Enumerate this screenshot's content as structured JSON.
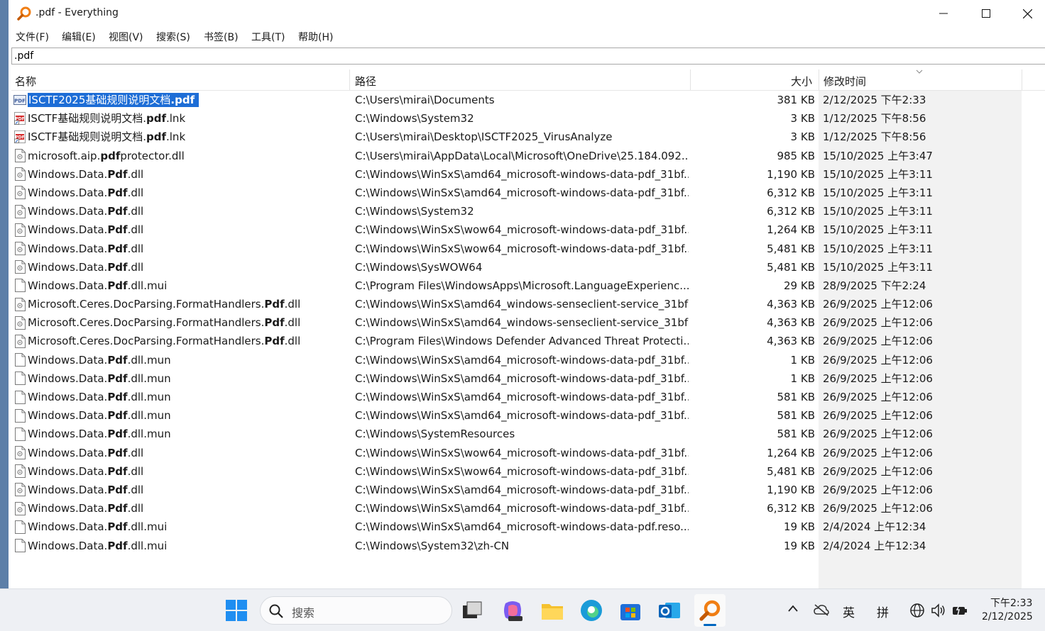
{
  "window": {
    "title": ".pdf - Everything",
    "app_icon": "magnifier-icon"
  },
  "menu": [
    "文件(F)",
    "编辑(E)",
    "视图(V)",
    "搜索(S)",
    "书签(B)",
    "工具(T)",
    "帮助(H)"
  ],
  "search": {
    "value": ".pdf"
  },
  "columns": {
    "name": "名称",
    "path": "路径",
    "size": "大小",
    "modified": "修改时间"
  },
  "rows": [
    {
      "pre": "ISCTF2025基础规则说明文档",
      "hl": ".pdf",
      "post": "",
      "path": "C:\\Users\\mirai\\Documents",
      "size": "381 KB",
      "modified": "2/12/2025 下午2:33",
      "icon": "pdf-file-icon",
      "selected": true
    },
    {
      "pre": "ISCTF基础规则说明文档.",
      "hl": "pdf",
      "post": ".lnk",
      "path": "C:\\Windows\\System32",
      "size": "3 KB",
      "modified": "1/12/2025 下午8:56",
      "icon": "pdf-shortcut-icon"
    },
    {
      "pre": "ISCTF基础规则说明文档.",
      "hl": "pdf",
      "post": ".lnk",
      "path": "C:\\Users\\mirai\\Desktop\\ISCTF2025_VirusAnalyze",
      "size": "3 KB",
      "modified": "1/12/2025 下午8:56",
      "icon": "pdf-shortcut-icon"
    },
    {
      "pre": "microsoft.aip.",
      "hl": "pdf",
      "post": "protector.dll",
      "path": "C:\\Users\\mirai\\AppData\\Local\\Microsoft\\OneDrive\\25.184.092...",
      "size": "985 KB",
      "modified": "15/10/2025 上午3:47",
      "icon": "dll-file-icon"
    },
    {
      "pre": "Windows.Data.",
      "hl": "Pdf",
      "post": ".dll",
      "path": "C:\\Windows\\WinSxS\\amd64_microsoft-windows-data-pdf_31bf...",
      "size": "1,190 KB",
      "modified": "15/10/2025 上午3:11",
      "icon": "dll-file-icon"
    },
    {
      "pre": "Windows.Data.",
      "hl": "Pdf",
      "post": ".dll",
      "path": "C:\\Windows\\WinSxS\\amd64_microsoft-windows-data-pdf_31bf...",
      "size": "6,312 KB",
      "modified": "15/10/2025 上午3:11",
      "icon": "dll-file-icon"
    },
    {
      "pre": "Windows.Data.",
      "hl": "Pdf",
      "post": ".dll",
      "path": "C:\\Windows\\System32",
      "size": "6,312 KB",
      "modified": "15/10/2025 上午3:11",
      "icon": "dll-file-icon"
    },
    {
      "pre": "Windows.Data.",
      "hl": "Pdf",
      "post": ".dll",
      "path": "C:\\Windows\\WinSxS\\wow64_microsoft-windows-data-pdf_31bf...",
      "size": "1,264 KB",
      "modified": "15/10/2025 上午3:11",
      "icon": "dll-file-icon"
    },
    {
      "pre": "Windows.Data.",
      "hl": "Pdf",
      "post": ".dll",
      "path": "C:\\Windows\\WinSxS\\wow64_microsoft-windows-data-pdf_31bf...",
      "size": "5,481 KB",
      "modified": "15/10/2025 上午3:11",
      "icon": "dll-file-icon"
    },
    {
      "pre": "Windows.Data.",
      "hl": "Pdf",
      "post": ".dll",
      "path": "C:\\Windows\\SysWOW64",
      "size": "5,481 KB",
      "modified": "15/10/2025 上午3:11",
      "icon": "dll-file-icon"
    },
    {
      "pre": "Windows.Data.",
      "hl": "Pdf",
      "post": ".dll.mui",
      "path": "C:\\Program Files\\WindowsApps\\Microsoft.LanguageExperienc...",
      "size": "29 KB",
      "modified": "28/9/2025 下午2:24",
      "icon": "file-icon"
    },
    {
      "pre": "Microsoft.Ceres.DocParsing.FormatHandlers.",
      "hl": "Pdf",
      "post": ".dll",
      "path": "C:\\Windows\\WinSxS\\amd64_windows-senseclient-service_31bf3...",
      "size": "4,363 KB",
      "modified": "26/9/2025 上午12:06",
      "icon": "dll-file-icon"
    },
    {
      "pre": "Microsoft.Ceres.DocParsing.FormatHandlers.",
      "hl": "Pdf",
      "post": ".dll",
      "path": "C:\\Windows\\WinSxS\\amd64_windows-senseclient-service_31bf3...",
      "size": "4,363 KB",
      "modified": "26/9/2025 上午12:06",
      "icon": "dll-file-icon"
    },
    {
      "pre": "Microsoft.Ceres.DocParsing.FormatHandlers.",
      "hl": "Pdf",
      "post": ".dll",
      "path": "C:\\Program Files\\Windows Defender Advanced Threat Protecti...",
      "size": "4,363 KB",
      "modified": "26/9/2025 上午12:06",
      "icon": "dll-file-icon"
    },
    {
      "pre": "Windows.Data.",
      "hl": "Pdf",
      "post": ".dll.mun",
      "path": "C:\\Windows\\WinSxS\\amd64_microsoft-windows-data-pdf_31bf...",
      "size": "1 KB",
      "modified": "26/9/2025 上午12:06",
      "icon": "file-icon"
    },
    {
      "pre": "Windows.Data.",
      "hl": "Pdf",
      "post": ".dll.mun",
      "path": "C:\\Windows\\WinSxS\\amd64_microsoft-windows-data-pdf_31bf...",
      "size": "1 KB",
      "modified": "26/9/2025 上午12:06",
      "icon": "file-icon"
    },
    {
      "pre": "Windows.Data.",
      "hl": "Pdf",
      "post": ".dll.mun",
      "path": "C:\\Windows\\WinSxS\\amd64_microsoft-windows-data-pdf_31bf...",
      "size": "581 KB",
      "modified": "26/9/2025 上午12:06",
      "icon": "file-icon"
    },
    {
      "pre": "Windows.Data.",
      "hl": "Pdf",
      "post": ".dll.mun",
      "path": "C:\\Windows\\WinSxS\\amd64_microsoft-windows-data-pdf_31bf...",
      "size": "581 KB",
      "modified": "26/9/2025 上午12:06",
      "icon": "file-icon"
    },
    {
      "pre": "Windows.Data.",
      "hl": "Pdf",
      "post": ".dll.mun",
      "path": "C:\\Windows\\SystemResources",
      "size": "581 KB",
      "modified": "26/9/2025 上午12:06",
      "icon": "file-icon"
    },
    {
      "pre": "Windows.Data.",
      "hl": "Pdf",
      "post": ".dll",
      "path": "C:\\Windows\\WinSxS\\wow64_microsoft-windows-data-pdf_31bf...",
      "size": "1,264 KB",
      "modified": "26/9/2025 上午12:06",
      "icon": "dll-file-icon"
    },
    {
      "pre": "Windows.Data.",
      "hl": "Pdf",
      "post": ".dll",
      "path": "C:\\Windows\\WinSxS\\wow64_microsoft-windows-data-pdf_31bf...",
      "size": "5,481 KB",
      "modified": "26/9/2025 上午12:06",
      "icon": "dll-file-icon"
    },
    {
      "pre": "Windows.Data.",
      "hl": "Pdf",
      "post": ".dll",
      "path": "C:\\Windows\\WinSxS\\amd64_microsoft-windows-data-pdf_31bf...",
      "size": "1,190 KB",
      "modified": "26/9/2025 上午12:06",
      "icon": "dll-file-icon"
    },
    {
      "pre": "Windows.Data.",
      "hl": "Pdf",
      "post": ".dll",
      "path": "C:\\Windows\\WinSxS\\amd64_microsoft-windows-data-pdf_31bf...",
      "size": "6,312 KB",
      "modified": "26/9/2025 上午12:06",
      "icon": "dll-file-icon"
    },
    {
      "pre": "Windows.Data.",
      "hl": "Pdf",
      "post": ".dll.mui",
      "path": "C:\\Windows\\WinSxS\\amd64_microsoft-windows-data-pdf.reso...",
      "size": "19 KB",
      "modified": "2/4/2024 上午12:34",
      "icon": "file-icon"
    },
    {
      "pre": "Windows.Data.",
      "hl": "Pdf",
      "post": ".dll.mui",
      "path": "C:\\Windows\\System32\\zh-CN",
      "size": "19 KB",
      "modified": "2/4/2024 上午12:34",
      "icon": "file-icon"
    }
  ],
  "taskbar": {
    "search_placeholder": "搜索",
    "tray_lang": "英",
    "tray_ime": "拼",
    "time": "下午2:33",
    "date": "2/12/2025"
  },
  "colors": {
    "selection": "#1d6dd6",
    "accent": "#0067c0",
    "everything_orange": "#f07e14"
  }
}
